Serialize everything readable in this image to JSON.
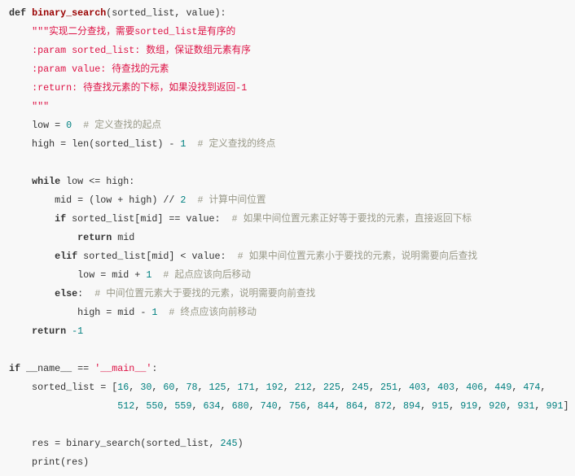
{
  "colors": {
    "background": "#f8f8f8",
    "text": "#333333",
    "keyword": "#333333",
    "function": "#990000",
    "string": "#dd1144",
    "number": "#008080",
    "comment": "#999988"
  },
  "code": {
    "language": "python",
    "lines": [
      [
        [
          "kw",
          "def"
        ],
        [
          "t",
          " "
        ],
        [
          "fn",
          "binary_search"
        ],
        [
          "t",
          "(sorted_list, value):"
        ]
      ],
      [
        [
          "t",
          "    "
        ],
        [
          "str",
          "\"\"\"实现二分查找，需要sorted_list是有序的"
        ]
      ],
      [
        [
          "t",
          "    "
        ],
        [
          "str",
          ":param sorted_list: 数组，保证数组元素有序"
        ]
      ],
      [
        [
          "t",
          "    "
        ],
        [
          "str",
          ":param value: 待查找的元素"
        ]
      ],
      [
        [
          "t",
          "    "
        ],
        [
          "str",
          ":return: 待查找元素的下标，如果没找到返回-1"
        ]
      ],
      [
        [
          "t",
          "    "
        ],
        [
          "str",
          "\"\"\""
        ]
      ],
      [
        [
          "t",
          "    low = "
        ],
        [
          "num",
          "0"
        ],
        [
          "t",
          "  "
        ],
        [
          "com",
          "# 定义查找的起点"
        ]
      ],
      [
        [
          "t",
          "    high = len(sorted_list) - "
        ],
        [
          "num",
          "1"
        ],
        [
          "t",
          "  "
        ],
        [
          "com",
          "# 定义查找的终点"
        ]
      ],
      [],
      [
        [
          "t",
          "    "
        ],
        [
          "kw",
          "while"
        ],
        [
          "t",
          " low <= high:"
        ]
      ],
      [
        [
          "t",
          "        mid = (low + high) // "
        ],
        [
          "num",
          "2"
        ],
        [
          "t",
          "  "
        ],
        [
          "com",
          "# 计算中间位置"
        ]
      ],
      [
        [
          "t",
          "        "
        ],
        [
          "kw",
          "if"
        ],
        [
          "t",
          " sorted_list[mid] == value:  "
        ],
        [
          "com",
          "# 如果中间位置元素正好等于要找的元素，直接返回下标"
        ]
      ],
      [
        [
          "t",
          "            "
        ],
        [
          "kw",
          "return"
        ],
        [
          "t",
          " mid"
        ]
      ],
      [
        [
          "t",
          "        "
        ],
        [
          "kw",
          "elif"
        ],
        [
          "t",
          " sorted_list[mid] < value:  "
        ],
        [
          "com",
          "# 如果中间位置元素小于要找的元素，说明需要向后查找"
        ]
      ],
      [
        [
          "t",
          "            low = mid + "
        ],
        [
          "num",
          "1"
        ],
        [
          "t",
          "  "
        ],
        [
          "com",
          "# 起点应该向后移动"
        ]
      ],
      [
        [
          "t",
          "        "
        ],
        [
          "kw",
          "else"
        ],
        [
          "t",
          ":  "
        ],
        [
          "com",
          "# 中间位置元素大于要找的元素，说明需要向前查找"
        ]
      ],
      [
        [
          "t",
          "            high = mid - "
        ],
        [
          "num",
          "1"
        ],
        [
          "t",
          "  "
        ],
        [
          "com",
          "# 终点应该向前移动"
        ]
      ],
      [
        [
          "t",
          "    "
        ],
        [
          "kw",
          "return"
        ],
        [
          "t",
          " "
        ],
        [
          "num",
          "-1"
        ]
      ],
      [],
      [
        [
          "kw",
          "if"
        ],
        [
          "t",
          " __name__ == "
        ],
        [
          "str",
          "'__main__'"
        ],
        [
          "t",
          ":"
        ]
      ],
      [
        [
          "t",
          "    sorted_list = ["
        ],
        [
          "num",
          "16"
        ],
        [
          "t",
          ", "
        ],
        [
          "num",
          "30"
        ],
        [
          "t",
          ", "
        ],
        [
          "num",
          "60"
        ],
        [
          "t",
          ", "
        ],
        [
          "num",
          "78"
        ],
        [
          "t",
          ", "
        ],
        [
          "num",
          "125"
        ],
        [
          "t",
          ", "
        ],
        [
          "num",
          "171"
        ],
        [
          "t",
          ", "
        ],
        [
          "num",
          "192"
        ],
        [
          "t",
          ", "
        ],
        [
          "num",
          "212"
        ],
        [
          "t",
          ", "
        ],
        [
          "num",
          "225"
        ],
        [
          "t",
          ", "
        ],
        [
          "num",
          "245"
        ],
        [
          "t",
          ", "
        ],
        [
          "num",
          "251"
        ],
        [
          "t",
          ", "
        ],
        [
          "num",
          "403"
        ],
        [
          "t",
          ", "
        ],
        [
          "num",
          "403"
        ],
        [
          "t",
          ", "
        ],
        [
          "num",
          "406"
        ],
        [
          "t",
          ", "
        ],
        [
          "num",
          "449"
        ],
        [
          "t",
          ", "
        ],
        [
          "num",
          "474"
        ],
        [
          "t",
          ","
        ]
      ],
      [
        [
          "t",
          "                   "
        ],
        [
          "num",
          "512"
        ],
        [
          "t",
          ", "
        ],
        [
          "num",
          "550"
        ],
        [
          "t",
          ", "
        ],
        [
          "num",
          "559"
        ],
        [
          "t",
          ", "
        ],
        [
          "num",
          "634"
        ],
        [
          "t",
          ", "
        ],
        [
          "num",
          "680"
        ],
        [
          "t",
          ", "
        ],
        [
          "num",
          "740"
        ],
        [
          "t",
          ", "
        ],
        [
          "num",
          "756"
        ],
        [
          "t",
          ", "
        ],
        [
          "num",
          "844"
        ],
        [
          "t",
          ", "
        ],
        [
          "num",
          "864"
        ],
        [
          "t",
          ", "
        ],
        [
          "num",
          "872"
        ],
        [
          "t",
          ", "
        ],
        [
          "num",
          "894"
        ],
        [
          "t",
          ", "
        ],
        [
          "num",
          "915"
        ],
        [
          "t",
          ", "
        ],
        [
          "num",
          "919"
        ],
        [
          "t",
          ", "
        ],
        [
          "num",
          "920"
        ],
        [
          "t",
          ", "
        ],
        [
          "num",
          "931"
        ],
        [
          "t",
          ", "
        ],
        [
          "num",
          "991"
        ],
        [
          "t",
          "]"
        ]
      ],
      [],
      [
        [
          "t",
          "    res = binary_search(sorted_list, "
        ],
        [
          "num",
          "245"
        ],
        [
          "t",
          ")"
        ]
      ],
      [
        [
          "t",
          "    print(res)"
        ]
      ]
    ]
  }
}
